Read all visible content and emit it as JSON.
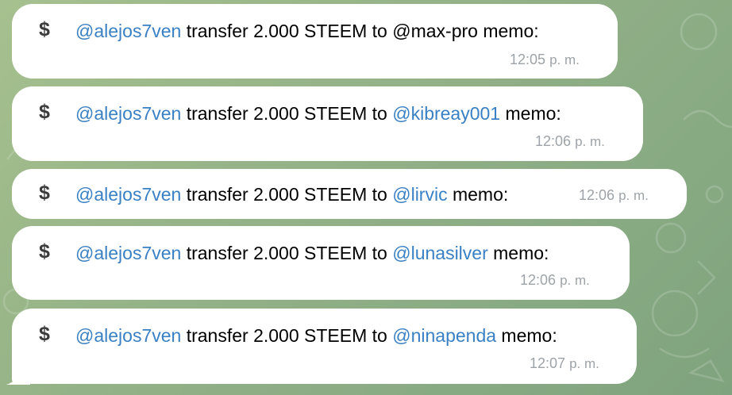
{
  "icons": {
    "dollar": "dollar-sign-icon"
  },
  "messages": [
    {
      "dollar": "$",
      "sender": "@alejos7ven",
      "text": " transfer 2.000 STEEM to ",
      "recipient": "@max-pro",
      "memo": " memo:",
      "time": "12:05",
      "ampm": "p. m."
    },
    {
      "dollar": "$",
      "sender": "@alejos7ven",
      "text": " transfer 2.000 STEEM to ",
      "recipient": "@kibreay001",
      "memo": " memo:",
      "time": "12:06",
      "ampm": "p. m."
    },
    {
      "dollar": "$",
      "sender": "@alejos7ven",
      "text": " transfer 2.000 STEEM to ",
      "recipient": "@lirvic",
      "memo": " memo:",
      "time": "12:06",
      "ampm": "p. m."
    },
    {
      "dollar": "$",
      "sender": "@alejos7ven",
      "text": " transfer 2.000 STEEM to ",
      "recipient": "@lunasilver",
      "memo": " memo:",
      "time": "12:06",
      "ampm": "p. m."
    },
    {
      "dollar": "$",
      "sender": "@alejos7ven",
      "text": " transfer 2.000 STEEM to ",
      "recipient": "@ninapenda",
      "memo": " memo:",
      "time": "12:07",
      "ampm": "p. m."
    }
  ]
}
